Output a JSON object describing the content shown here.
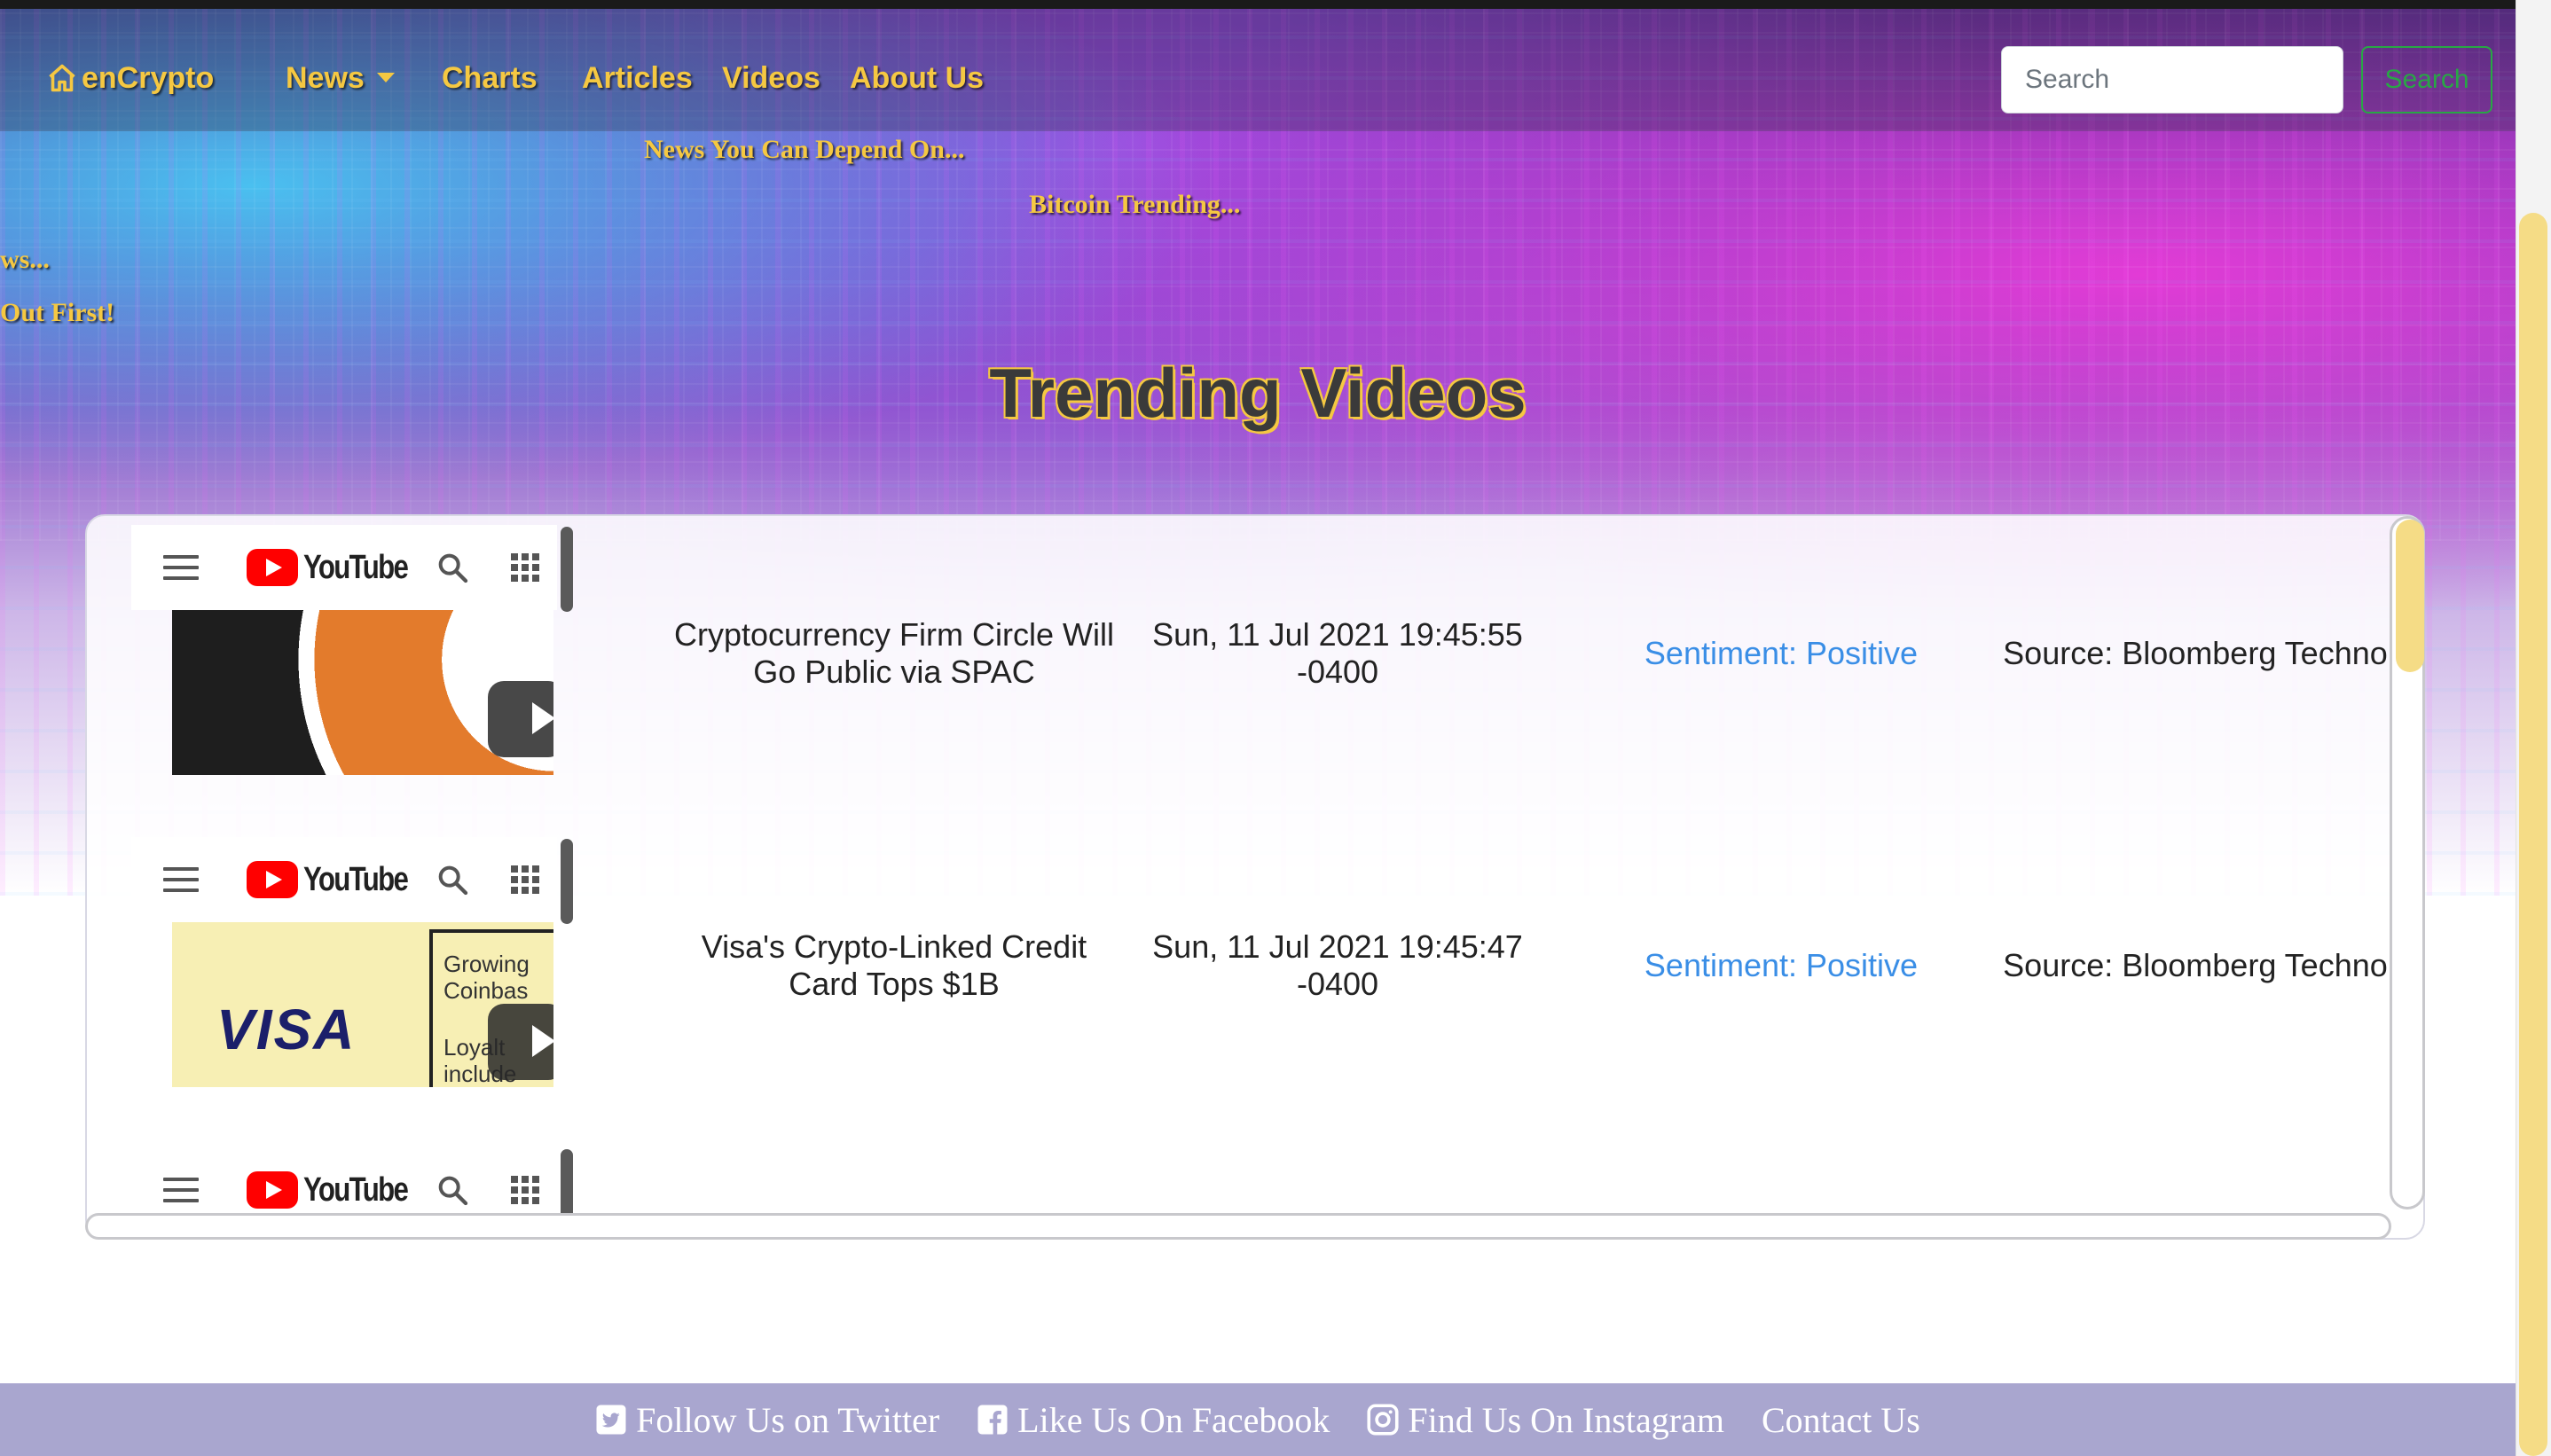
{
  "navbar": {
    "brand": "enCrypto",
    "items": [
      {
        "label": "News",
        "has_dropdown": true
      },
      {
        "label": "Charts"
      },
      {
        "label": "Articles"
      },
      {
        "label": "Videos"
      },
      {
        "label": "About Us"
      }
    ],
    "search_placeholder": "Search",
    "search_button": "Search"
  },
  "taglines": [
    "News You Can Depend On...",
    "Bitcoin Trending...",
    "ws...",
    "Out First!"
  ],
  "page_title": "Trending Videos",
  "youtube": {
    "logo_text": "YouTube"
  },
  "videos": [
    {
      "title": "Cryptocurrency Firm Circle Will Go Public via SPAC",
      "date": "Sun, 11 Jul 2021 19:45:55 -0400",
      "sentiment": "Sentiment: Positive",
      "source": "Source: Bloomberg Technology"
    },
    {
      "title": "Visa's Crypto-Linked Credit Card Tops $1B",
      "date": "Sun, 11 Jul 2021 19:45:47 -0400",
      "sentiment": "Sentiment: Positive",
      "source": "Source: Bloomberg Technology",
      "thumb_text": {
        "logo": "VISA",
        "card_lines": [
          "Growing",
          "Coinbas",
          "Loyalt",
          "include"
        ]
      }
    }
  ],
  "footer": {
    "links": [
      {
        "label": "Follow Us on Twitter",
        "icon": "twitter-icon"
      },
      {
        "label": "Like Us On Facebook",
        "icon": "facebook-icon"
      },
      {
        "label": "Find Us On Instagram",
        "icon": "instagram-icon"
      },
      {
        "label": "Contact Us"
      }
    ]
  },
  "colors": {
    "accent_gold": "#f5c842",
    "sentiment_blue": "#3a8ee6",
    "footer_bg": "#a9a6cf",
    "search_green": "#28a745"
  }
}
